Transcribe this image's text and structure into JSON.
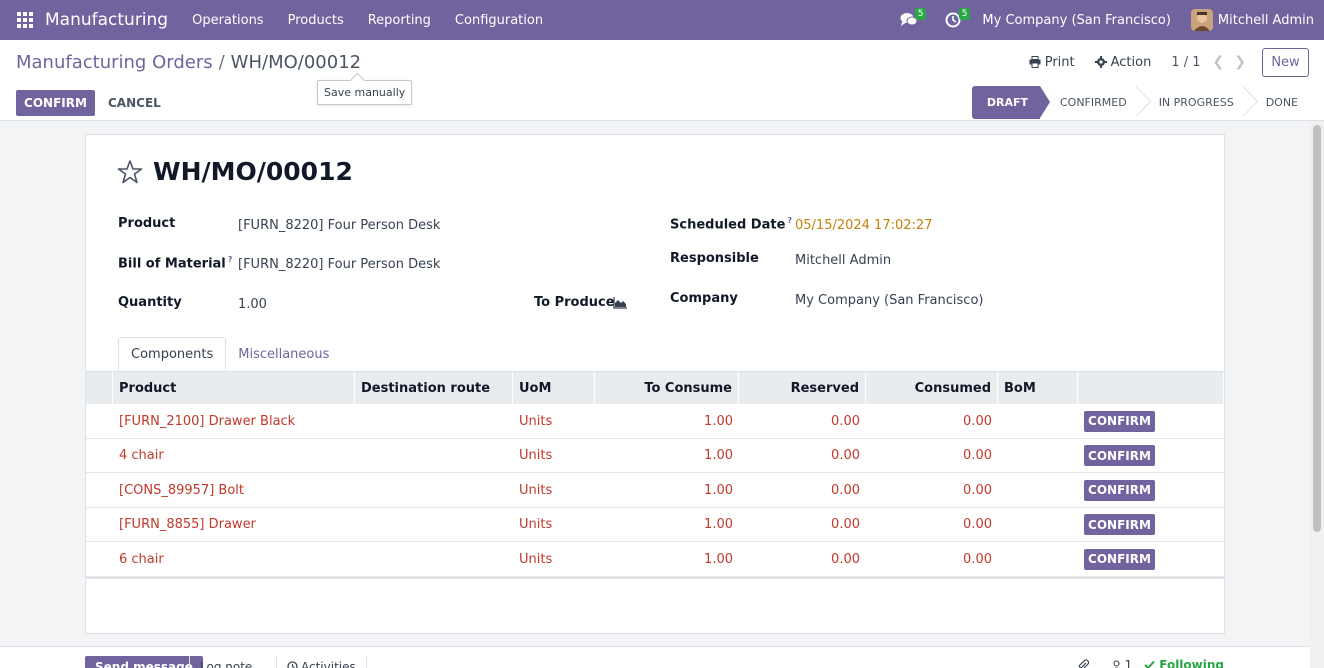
{
  "navbar": {
    "app_title": "Manufacturing",
    "menu": [
      "Operations",
      "Products",
      "Reporting",
      "Configuration"
    ],
    "messages_count": "5",
    "activities_count": "5",
    "company": "My Company (San Francisco)",
    "user": "Mitchell Admin"
  },
  "breadcrumb": {
    "parent": "Manufacturing Orders",
    "separator": "/",
    "current": "WH/MO/00012"
  },
  "tooltip": "Save manually",
  "control_panel": {
    "print_label": "Print",
    "action_label": "Action",
    "pager": "1 / 1",
    "new_label": "New",
    "confirm_label": "CONFIRM",
    "cancel_label": "CANCEL"
  },
  "statusbar": [
    "DRAFT",
    "CONFIRMED",
    "IN PROGRESS",
    "DONE"
  ],
  "record": {
    "title": "WH/MO/00012",
    "product_label": "Product",
    "product_value": "[FURN_8220] Four Person Desk",
    "bom_label": "Bill of Material",
    "bom_help": "?",
    "bom_value": "[FURN_8220] Four Person Desk",
    "quantity_label": "Quantity",
    "quantity_value": "1.00",
    "to_produce_label": "To Produce",
    "scheduled_label": "Scheduled Date",
    "scheduled_help": "?",
    "scheduled_value": "05/15/2024 17:02:27",
    "responsible_label": "Responsible",
    "responsible_value": "Mitchell Admin",
    "company_label": "Company",
    "company_value": "My Company (San Francisco)"
  },
  "tabs": [
    "Components",
    "Miscellaneous"
  ],
  "table": {
    "headers": [
      "Product",
      "Destination route",
      "UoM",
      "To Consume",
      "Reserved",
      "Consumed",
      "BoM"
    ],
    "rows": [
      {
        "product": "[FURN_2100] Drawer Black",
        "uom": "Units",
        "to_consume": "1.00",
        "reserved": "0.00",
        "consumed": "0.00",
        "button": "CONFIRM"
      },
      {
        "product": "4 chair",
        "uom": "Units",
        "to_consume": "1.00",
        "reserved": "0.00",
        "consumed": "0.00",
        "button": "CONFIRM"
      },
      {
        "product": "[CONS_89957] Bolt",
        "uom": "Units",
        "to_consume": "1.00",
        "reserved": "0.00",
        "consumed": "0.00",
        "button": "CONFIRM"
      },
      {
        "product": "[FURN_8855] Drawer",
        "uom": "Units",
        "to_consume": "1.00",
        "reserved": "0.00",
        "consumed": "0.00",
        "button": "CONFIRM"
      },
      {
        "product": "6 chair",
        "uom": "Units",
        "to_consume": "1.00",
        "reserved": "0.00",
        "consumed": "0.00",
        "button": "CONFIRM"
      }
    ]
  },
  "chatter": {
    "send_message": "Send message",
    "log_note": "Log note",
    "activities": "Activities",
    "followers_count": "1",
    "following": "Following"
  }
}
